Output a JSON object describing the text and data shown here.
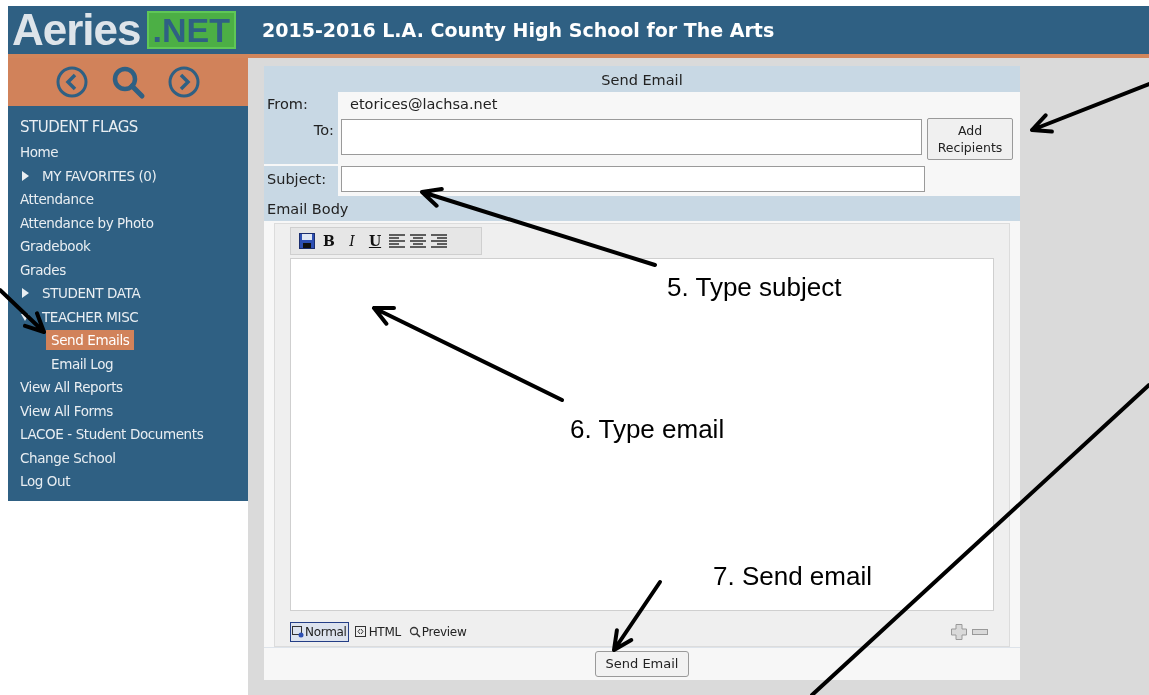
{
  "header": {
    "logo": "Aeries",
    "logo_badge": ".NET",
    "title": "2015-2016 L.A. County High School for The Arts"
  },
  "sidebar": {
    "heading": "STUDENT FLAGS",
    "items": [
      {
        "label": "Home",
        "selected": false
      },
      {
        "label": "MY FAVORITES (0)",
        "selected": false,
        "expanded": false
      },
      {
        "label": "Attendance",
        "selected": false
      },
      {
        "label": "Attendance by Photo",
        "selected": false
      },
      {
        "label": "Gradebook",
        "selected": false
      },
      {
        "label": "Grades",
        "selected": false
      },
      {
        "label": "STUDENT DATA",
        "selected": false,
        "expanded": false
      },
      {
        "label": "TEACHER MISC",
        "selected": false,
        "expanded": true,
        "children": [
          {
            "label": "Send Emails",
            "selected": true
          },
          {
            "label": "Email Log",
            "selected": false
          }
        ]
      },
      {
        "label": "View All Reports",
        "selected": false
      },
      {
        "label": "View All Forms",
        "selected": false
      },
      {
        "label": "LACOE - Student Documents",
        "selected": false
      },
      {
        "label": "Change School",
        "selected": false
      },
      {
        "label": "Log Out",
        "selected": false
      }
    ]
  },
  "form": {
    "title": "Send Email",
    "from_label": "From:",
    "from_value": "etorices@lachsa.net",
    "to_label": "To:",
    "add_button": "Add Recipients",
    "subject_label": "Subject:",
    "body_label": "Email Body",
    "toolbar": [
      {
        "kind": "save"
      },
      {
        "kind": "bold",
        "label": "B"
      },
      {
        "kind": "italic",
        "label": "I"
      },
      {
        "kind": "underline",
        "label": "U"
      },
      {
        "kind": "align-left"
      },
      {
        "kind": "align-center"
      },
      {
        "kind": "align-right"
      }
    ],
    "modes": [
      {
        "label": "Normal",
        "selected": true,
        "kind": "normal"
      },
      {
        "label": "HTML",
        "selected": false,
        "kind": "html"
      },
      {
        "label": "Preview",
        "selected": false,
        "kind": "preview"
      }
    ],
    "send_button": "Send Email"
  },
  "annotations": [
    {
      "text": "5.  Type subject"
    },
    {
      "text": "6.  Type email"
    },
    {
      "text": "7. Send email"
    }
  ]
}
